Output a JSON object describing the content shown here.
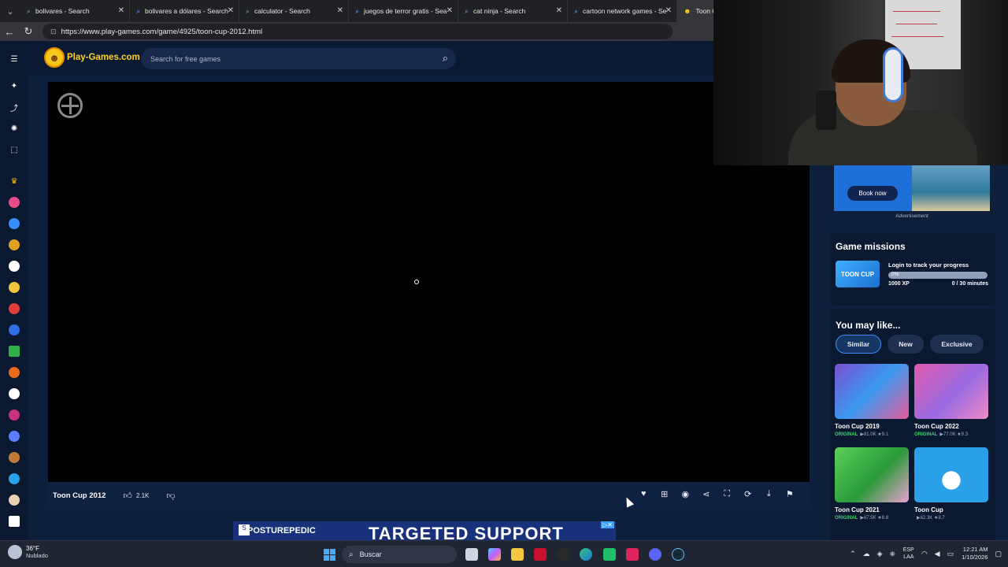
{
  "browser": {
    "tabs": [
      {
        "title": "bolivares - Search"
      },
      {
        "title": "bolivares a dólares - Search"
      },
      {
        "title": "calculator - Search"
      },
      {
        "title": "juegos de terror gratis - Sea"
      },
      {
        "title": "cat ninja - Search"
      },
      {
        "title": "cartoon network games - Se"
      },
      {
        "title": "Toon C"
      }
    ],
    "url": "https://www.play-games.com/game/4925/toon-cup-2012.html"
  },
  "site": {
    "logo_text": "Play-Games.com",
    "search_placeholder": "Search for free games"
  },
  "game": {
    "title": "Toon Cup 2012",
    "likes": "2.1K"
  },
  "ads": {
    "side_button": "Book now",
    "side_label": "Advertisement",
    "bottom_brand": "POSTUREPEDIC",
    "bottom_headline": "TARGETED SUPPORT"
  },
  "missions": {
    "heading": "Game missions",
    "thumb_text": "TOON CUP",
    "login_text": "Login to track your progress",
    "progress_text": "0%",
    "progress_value": 0,
    "xp": "1000 XP",
    "minutes": "0 / 30 minutes"
  },
  "recommendations": {
    "heading": "You may like...",
    "tabs": [
      "Similar",
      "New",
      "Exclusive"
    ],
    "games": [
      {
        "name": "Toon Cup 2019",
        "badge": "ORIGINAL",
        "stats": "▶81.0K ★9.1"
      },
      {
        "name": "Toon Cup 2022",
        "badge": "ORIGINAL",
        "stats": "▶77.0K ★9.3"
      },
      {
        "name": "Toon Cup 2021",
        "badge": "ORIGINAL",
        "stats": "▶67.5K ★8.8"
      },
      {
        "name": "Toon Cup",
        "badge": "",
        "stats": "▶62.3K ★8.7"
      }
    ]
  },
  "taskbar": {
    "temp": "36°F",
    "weather": "Nublado",
    "search": "Buscar",
    "lang1": "ESP",
    "lang2": "LAA",
    "time": "12:21 AM",
    "date": "1/10/2026"
  },
  "colors": {
    "accent": "#1e6fd8",
    "logo_yellow": "#ffd21f",
    "original_green": "#3dd36c"
  }
}
